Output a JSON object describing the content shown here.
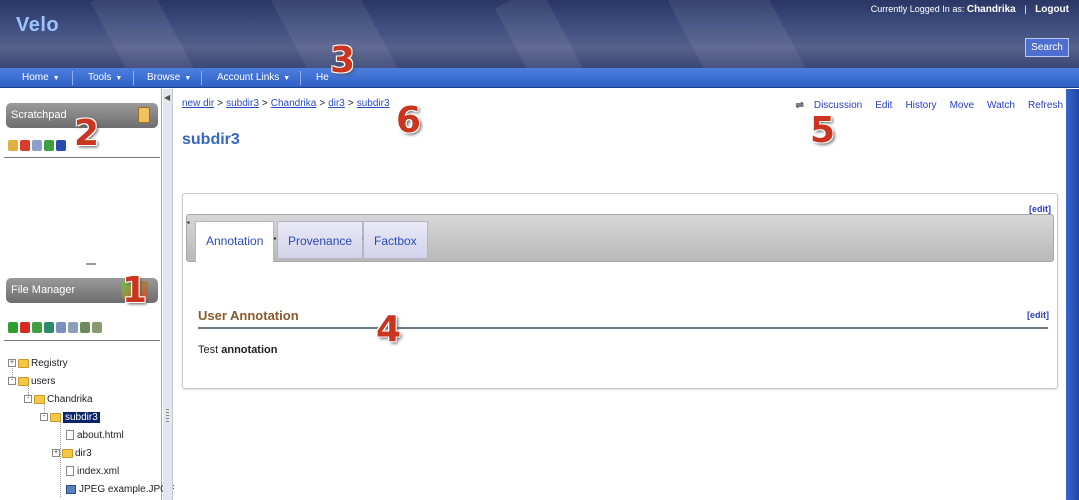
{
  "app": {
    "logo": "Velo",
    "logged_in_label": "Currently Logged In as:",
    "username": "Chandrika",
    "logout": "Logout",
    "search": "Search"
  },
  "nav": {
    "items": [
      {
        "label": "Home"
      },
      {
        "label": "Tools"
      },
      {
        "label": "Browse"
      },
      {
        "label": "Account Links"
      },
      {
        "label": "He"
      }
    ]
  },
  "scratchpad": {
    "title": "Scratchpad",
    "icon": "clipboard-icon"
  },
  "file_manager": {
    "title": "File Manager",
    "icon": "folder-tools-icon",
    "tree": [
      {
        "label": "Registry",
        "type": "folder",
        "toggle": "+"
      },
      {
        "label": "users",
        "type": "folder",
        "toggle": "-"
      },
      {
        "label": "Chandrika",
        "type": "folder",
        "toggle": "-"
      },
      {
        "label": "subdir3",
        "type": "folder",
        "toggle": "-",
        "selected": true
      },
      {
        "label": "about.html",
        "type": "file"
      },
      {
        "label": "dir3",
        "type": "folder",
        "toggle": "+"
      },
      {
        "label": "index.xml",
        "type": "file"
      },
      {
        "label": "JPEG example.JPG R",
        "type": "image"
      }
    ]
  },
  "breadcrumb": {
    "items": [
      "new dir",
      "subdir3",
      "Chandrika",
      "dir3",
      "subdir3"
    ],
    "separator": ">"
  },
  "page": {
    "title": "subdir3"
  },
  "actions": [
    "Discussion",
    "Edit",
    "History",
    "Move",
    "Watch",
    "Refresh"
  ],
  "content": {
    "top_edit": "[edit]",
    "tabs": [
      "Annotation",
      "Provenance",
      "Factbox"
    ],
    "tab_marker": "▪",
    "annotation_heading": "User Annotation",
    "annotation_edit": "[edit]",
    "annotation_text_plain": "Test",
    "annotation_text_bold": "annotation"
  },
  "callouts": [
    "1",
    "2",
    "3",
    "4",
    "5",
    "6"
  ],
  "colors": {
    "nav_blue": "#3a6bd4",
    "link_blue": "#2a3dc0",
    "title_blue": "#3467c4",
    "heading_brown": "#8b5a2b",
    "callout_red": "#c9351f"
  }
}
